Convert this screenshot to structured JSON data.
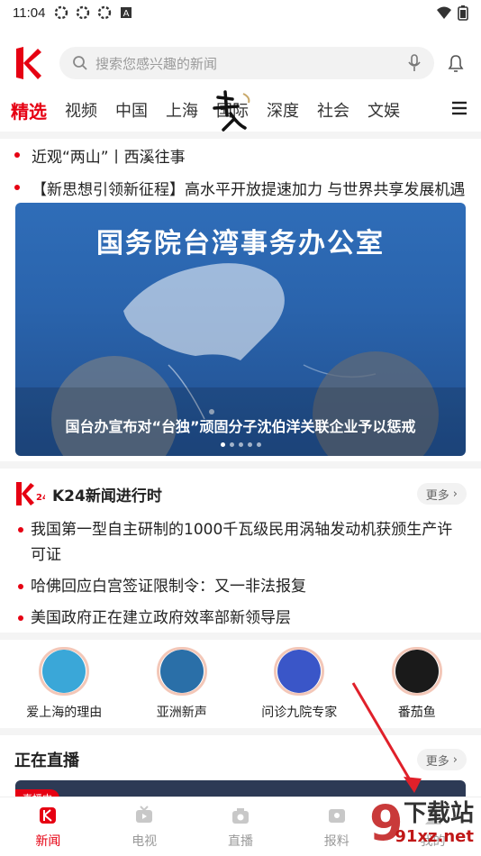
{
  "status_bar": {
    "time": "11:04",
    "icons": [
      "gear-icon",
      "gear-icon",
      "gear-icon",
      "a-icon"
    ],
    "right_icons": [
      "wifi-icon",
      "battery-icon"
    ]
  },
  "header": {
    "logo": "K",
    "search_placeholder": "搜索您感兴趣的新闻",
    "mic_icon": "mic-icon",
    "bell_icon": "bell-icon"
  },
  "nav": {
    "tabs": [
      "精选",
      "视频",
      "中国",
      "上海",
      "国际",
      "深度",
      "社会",
      "文娱"
    ],
    "active_index": 0,
    "menu_icon": "menu-icon"
  },
  "headlines": [
    "近观“两山”丨西溪往事",
    "【新思想引领新征程】高水平开放提速加力 与世界共享发展机遇"
  ],
  "banner": {
    "title": "国务院台湾事务办公室",
    "caption": "国台办宣布对“台独”顽固分子沈伯洋关联企业予以惩戒",
    "dot_count": 5,
    "active_dot": 0
  },
  "k24": {
    "logo": "K24",
    "title": "K24新闻进行时",
    "more": "更多",
    "items": [
      "我国第一型自主研制的1000千瓦级民用涡轴发动机获颁生产许可证",
      "哈佛回应白宫签证限制令：又一非法报复",
      "美国政府正在建立政府效率部新领导层"
    ]
  },
  "channels": [
    {
      "label": "爱上海的理由",
      "color": "#3aa7d8"
    },
    {
      "label": "亚洲新声",
      "color": "#2a6fa8"
    },
    {
      "label": "问诊九院专家",
      "color": "#3a56c8"
    },
    {
      "label": "番茄鱼",
      "color": "#1a1a1a"
    }
  ],
  "live": {
    "title": "正在直播",
    "more": "更多",
    "tag": "直播中"
  },
  "bottom_nav": [
    {
      "label": "新闻",
      "icon": "news-icon",
      "active": true
    },
    {
      "label": "电视",
      "icon": "tv-icon",
      "active": false
    },
    {
      "label": "直播",
      "icon": "camera-icon",
      "active": false
    },
    {
      "label": "报料",
      "icon": "report-icon",
      "active": false
    },
    {
      "label": "我的",
      "icon": "profile-icon",
      "active": false
    }
  ],
  "watermark": {
    "line1": "下载站",
    "line2": "91xz.net"
  },
  "colors": {
    "brand_red": "#e60012",
    "banner_blue": "#2f6db8"
  }
}
